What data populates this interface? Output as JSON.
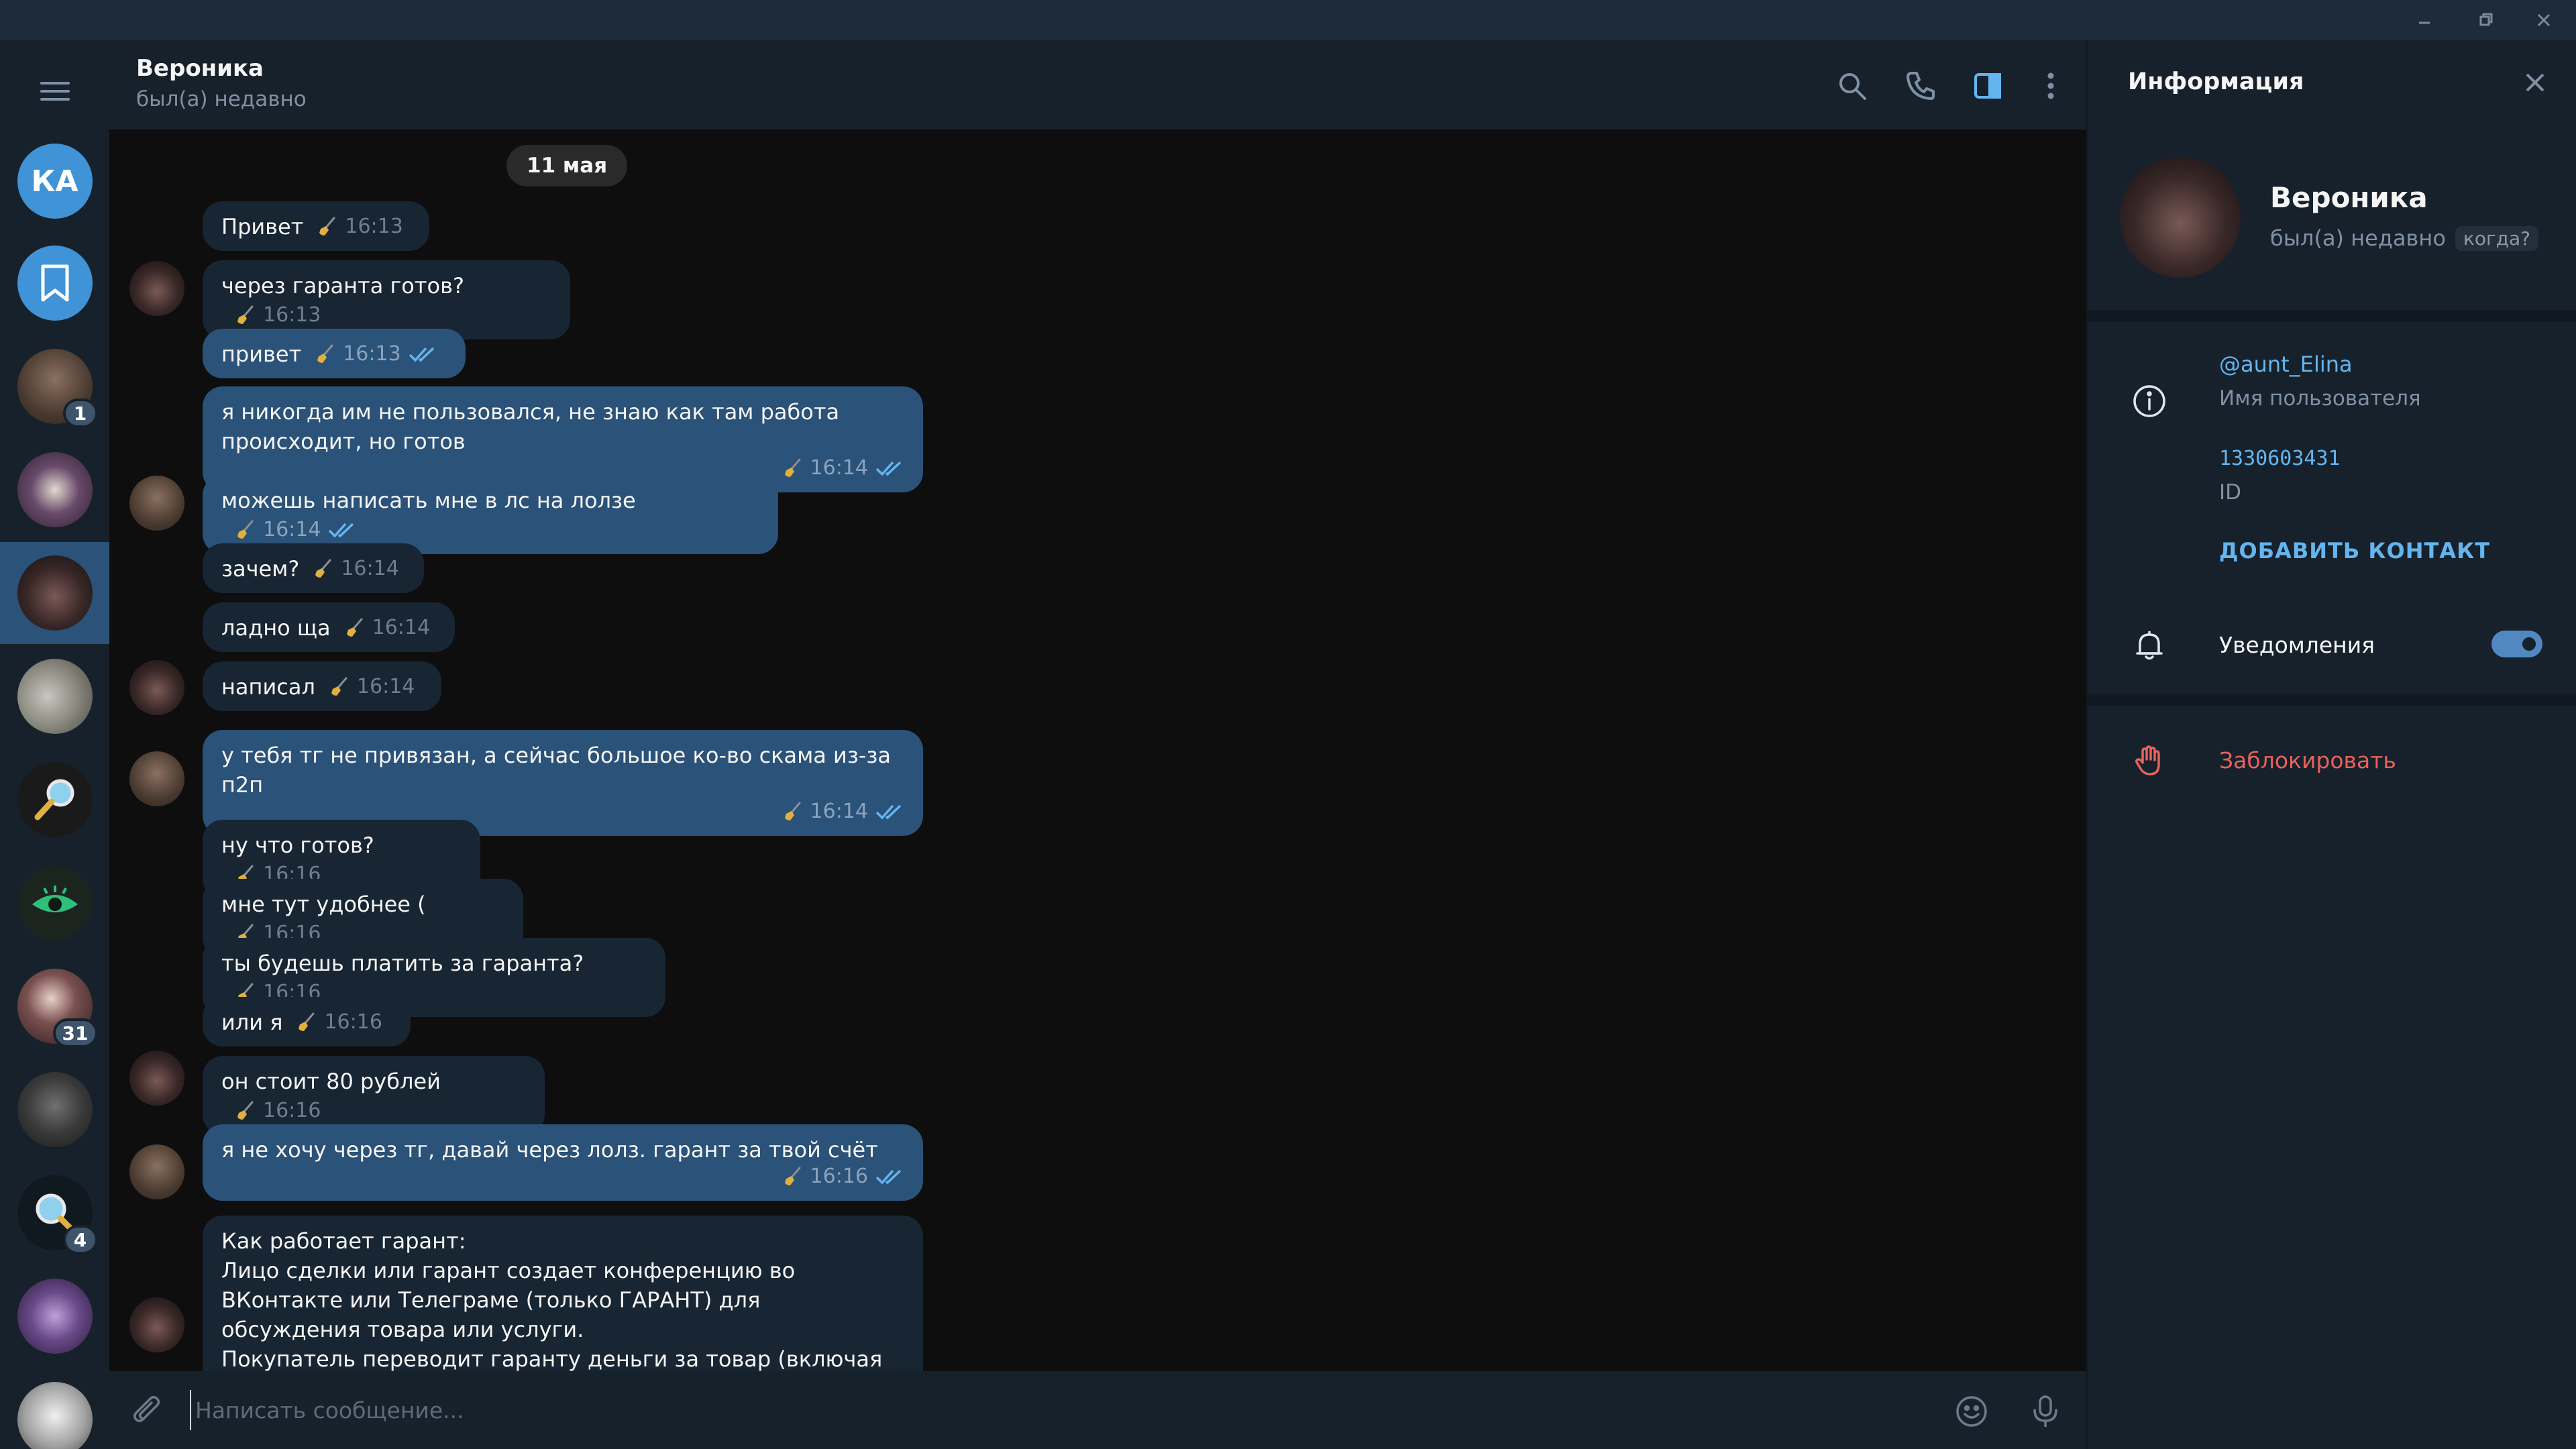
{
  "rail": {
    "items": [
      {
        "id": "menu",
        "kind": "menu"
      },
      {
        "id": "ka",
        "initials": "КА",
        "color": "#3f93d6"
      },
      {
        "id": "saved",
        "kind": "bookmark",
        "color": "#3f93d6"
      },
      {
        "id": "chat1",
        "badge": "1",
        "color": "#5a4a3c"
      },
      {
        "id": "chat2",
        "color": "#4a3a4a"
      },
      {
        "id": "chat3",
        "active": true,
        "color": "#3a2a2a"
      },
      {
        "id": "chat4",
        "color": "#8a8a80"
      },
      {
        "id": "chat5",
        "color": "#2a2a2a"
      },
      {
        "id": "chat6",
        "color": "#1a3a2a"
      },
      {
        "id": "chat7",
        "badge": "31",
        "color": "#4a3a3a"
      },
      {
        "id": "chat8",
        "color": "#3a3a3a"
      },
      {
        "id": "chat9",
        "badge": "4",
        "color": "#202a34"
      },
      {
        "id": "chat10",
        "color": "#4a3a6a"
      },
      {
        "id": "chat11",
        "color": "#d8d8d8"
      }
    ]
  },
  "header": {
    "title": "Вероника",
    "status": "был(а) недавно",
    "icons": [
      "search-icon",
      "phone-icon",
      "sidebar-toggle-icon",
      "more-icon"
    ]
  },
  "messages": {
    "date": "11 мая",
    "list": [
      {
        "dir": "in",
        "text": "Привет",
        "time": "16:13"
      },
      {
        "dir": "in",
        "text": "через гаранта готов?",
        "time": "16:13"
      },
      {
        "dir": "out",
        "text": "привет",
        "time": "16:13"
      },
      {
        "dir": "out",
        "text": "я никогда им не пользовался, не знаю как там работа происходит, но готов",
        "time": "16:14"
      },
      {
        "dir": "out",
        "text": "можешь написать мне в лс на лолзе",
        "time": "16:14"
      },
      {
        "dir": "in",
        "text": "зачем?",
        "time": "16:14"
      },
      {
        "dir": "in",
        "text": "ладно ща",
        "time": "16:14"
      },
      {
        "dir": "in",
        "text": "написал",
        "time": "16:14"
      },
      {
        "dir": "out",
        "text": "у тебя тг не привязан, а сейчас большое ко-во скама из-за п2п",
        "time": "16:14"
      },
      {
        "dir": "in",
        "text": "ну что готов?",
        "time": "16:16"
      },
      {
        "dir": "in",
        "text": "мне тут удобнее (",
        "time": "16:16"
      },
      {
        "dir": "in",
        "text": "ты будешь платить за гаранта?",
        "time": "16:16"
      },
      {
        "dir": "in",
        "text": "или я",
        "time": "16:16"
      },
      {
        "dir": "in",
        "text": "он стоит 80 рублей",
        "time": "16:16"
      },
      {
        "dir": "out",
        "text": "я не хочу через тг, давай через лолз. гарант за твой счёт",
        "time": "16:16"
      },
      {
        "dir": "in",
        "text": "Как работает гарант:\nЛицо сделки или гарант создает конференцию во ВКонтакте или Телеграме (только ГАРАНТ) для обсуждения товара или услуги.\nПокупатель переводит гаранту деньги за товар (включая оплату гаранта).",
        "time": ""
      }
    ]
  },
  "composer": {
    "placeholder": "Написать сообщение..."
  },
  "info": {
    "title": "Информация",
    "name": "Вероника",
    "status": "был(а) недавно",
    "when": "когда?",
    "username": "@aunt_Elina",
    "username_label": "Имя пользователя",
    "id_value": "1330603431",
    "id_label": "ID",
    "add_contact": "ДОБАВИТЬ КОНТАКТ",
    "notifications": "Уведомления",
    "notifications_on": true,
    "block": "Заблокировать"
  },
  "colors": {
    "accent": "#64b5ef",
    "outgoing": "#2b5278",
    "incoming": "#182533",
    "danger": "#e8625b"
  }
}
